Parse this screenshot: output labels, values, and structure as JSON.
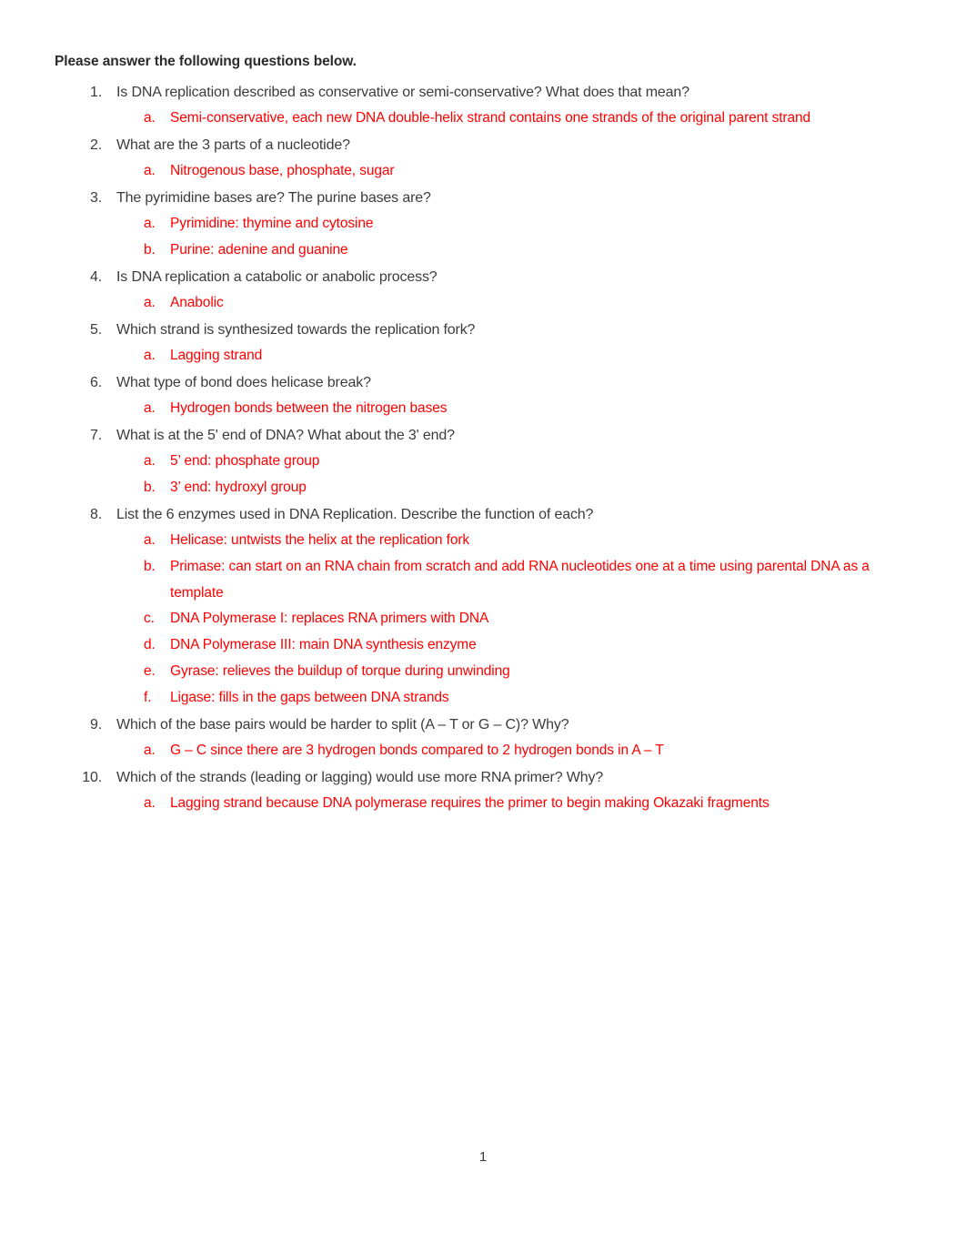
{
  "document": {
    "heading": "Please answer the following questions below.",
    "page_number": "1",
    "text_color": "#3b3b3b",
    "answer_color": "#ff0000",
    "questions": [
      {
        "marker": "1.",
        "text": "Is DNA replication described as conservative or semi-conservative? What does that mean?",
        "answers": [
          {
            "marker": "a.",
            "text": "Semi-conservative, each new DNA double-helix strand contains one strands of the original parent strand"
          }
        ]
      },
      {
        "marker": "2.",
        "text": "What are the 3 parts of a nucleotide?",
        "answers": [
          {
            "marker": "a.",
            "text": "Nitrogenous base, phosphate, sugar"
          }
        ]
      },
      {
        "marker": "3.",
        "text": "The pyrimidine bases are? The purine bases are?",
        "answers": [
          {
            "marker": "a.",
            "text": "Pyrimidine: thymine and cytosine"
          },
          {
            "marker": "b.",
            "text": "Purine: adenine and guanine"
          }
        ]
      },
      {
        "marker": "4.",
        "text": "Is DNA replication a catabolic or anabolic process?",
        "answers": [
          {
            "marker": "a.",
            "text": "Anabolic"
          }
        ]
      },
      {
        "marker": "5.",
        "text": "Which strand is synthesized towards the replication fork?",
        "answers": [
          {
            "marker": "a.",
            "text": "Lagging strand"
          }
        ]
      },
      {
        "marker": "6.",
        "text": "What type of bond does helicase break?",
        "answers": [
          {
            "marker": "a.",
            "text": "Hydrogen bonds between the nitrogen bases"
          }
        ]
      },
      {
        "marker": "7.",
        "text": "What is at the 5' end of DNA? What about the 3' end?",
        "answers": [
          {
            "marker": "a.",
            "text": "5’ end: phosphate group"
          },
          {
            "marker": "b.",
            "text": "3’ end: hydroxyl group"
          }
        ]
      },
      {
        "marker": "8.",
        "text": "List the 6 enzymes used in DNA Replication. Describe the function of each?",
        "answers": [
          {
            "marker": "a.",
            "text": "Helicase: untwists the helix at the replication fork"
          },
          {
            "marker": "b.",
            "text": "Primase: can start on an RNA chain from scratch and add RNA nucleotides one at a time using parental DNA as a template"
          },
          {
            "marker": "c.",
            "text": "DNA Polymerase I: replaces RNA primers with DNA"
          },
          {
            "marker": "d.",
            "text": "DNA Polymerase III: main DNA synthesis enzyme"
          },
          {
            "marker": "e.",
            "text": "Gyrase: relieves the buildup of torque during unwinding"
          },
          {
            "marker": "f.",
            "text": "Ligase: fills in the gaps between DNA strands"
          }
        ]
      },
      {
        "marker": "9.",
        "text": "Which of the base pairs would be harder to split (A – T or G – C)? Why?",
        "answers": [
          {
            "marker": "a.",
            "text": "G – C since there are 3 hydrogen bonds compared to 2 hydrogen bonds in A – T"
          }
        ]
      },
      {
        "marker": "10.",
        "text": "Which of the strands (leading or lagging) would use more RNA primer? Why?",
        "answers": [
          {
            "marker": "a.",
            "text": "Lagging strand because DNA polymerase requires the primer to begin making Okazaki fragments"
          }
        ]
      }
    ]
  }
}
